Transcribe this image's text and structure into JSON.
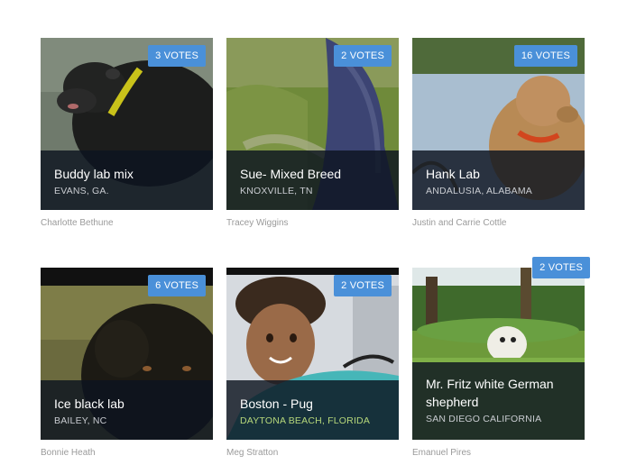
{
  "cards": [
    {
      "name": "Buddy lab mix",
      "location": "EVANS, GA.",
      "votes": "3 VOTES",
      "owner": "Charlotte Bethune",
      "icon": "black-lab-dog-photo"
    },
    {
      "name": "Sue- Mixed Breed",
      "location": "KNOXVILLE, TN",
      "votes": "2 VOTES",
      "owner": "Tracey Wiggins",
      "icon": "mixed-breed-dog-photo"
    },
    {
      "name": "Hank Lab",
      "location": "ANDALUSIA, ALABAMA",
      "votes": "16 VOTES",
      "owner": "Justin and Carrie Cottle",
      "icon": "yellow-lab-dog-photo"
    },
    {
      "name": "Ice black lab",
      "location": "BAILEY, NC",
      "votes": "6 VOTES",
      "owner": "Bonnie Heath",
      "icon": "black-lab-dog-photo"
    },
    {
      "name": "Boston - Pug",
      "location": "DAYTONA BEACH, FLORIDA",
      "votes": "2 VOTES",
      "owner": "Meg Stratton",
      "icon": "child-photo"
    },
    {
      "name": "Mr. Fritz white German shepherd",
      "location": "SAN DIEGO CALIFORNIA",
      "votes": "2 VOTES",
      "owner": "Emanuel Pires",
      "icon": "white-puppy-photo"
    }
  ],
  "colors": {
    "vote_badge": "#4a90d9",
    "caption_overlay": "#0c1420",
    "owner_text": "#9a9a9a",
    "location_accent": "#b6d77a"
  }
}
